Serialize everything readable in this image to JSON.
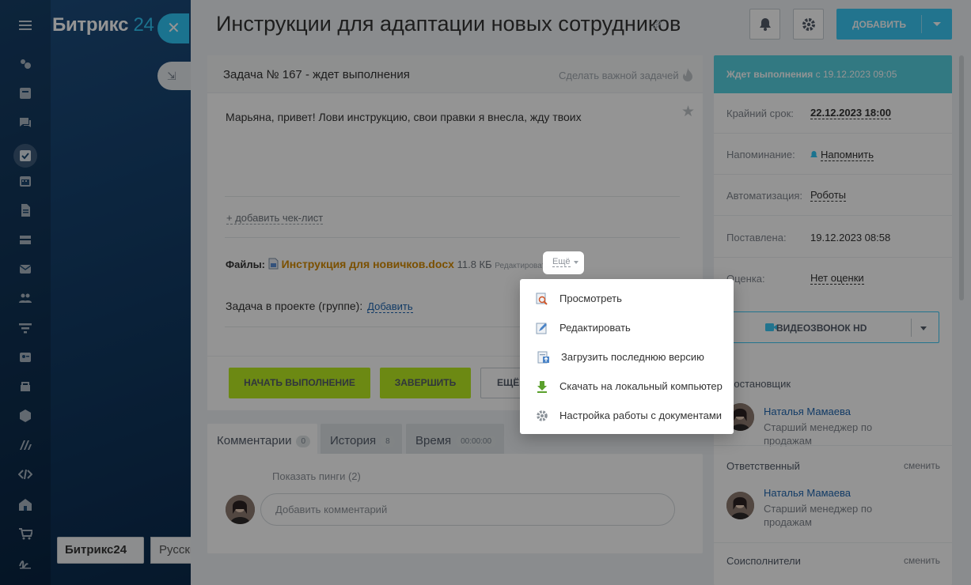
{
  "app": {
    "logo_name": "Битрикс",
    "logo_num": "24",
    "footer_logo": "Битрикс24",
    "footer_lang": "Русский"
  },
  "page": {
    "title": "Инструкции для адаптации новых сотрудников",
    "add_button": "ДОБАВИТЬ"
  },
  "task": {
    "header": "Задача № 167 - ждет выполнения",
    "important": "Сделать важной задачей",
    "description": "Марьяна, привет! Лови инструкцию, свои правки я внесла, жду твоих",
    "checklist": "+ добавить чек-лист",
    "files_label": "Файлы:",
    "file_name": "Инструкция для новичков.docx",
    "file_size": "11.8 КБ",
    "file_edit": "Редактировать",
    "file_more": "Ещё",
    "project_label": "Задача в проекте (группе):",
    "project_add": "Добавить",
    "btn_start": "НАЧАТЬ ВЫПОЛНЕНИЕ",
    "btn_finish": "ЗАВЕРШИТЬ",
    "btn_more": "ЕЩЁ"
  },
  "tabs": [
    {
      "label": "Комментарии",
      "count": "0"
    },
    {
      "label": "История",
      "count": "8"
    },
    {
      "label": "Время",
      "count": "00:00:00"
    }
  ],
  "comments": {
    "pings": "Показать пинги (2)",
    "placeholder": "Добавить комментарий"
  },
  "sidebar": {
    "status": "Ждет выполнения",
    "status_since": "с 19.12.2023 09:05",
    "deadline_label": "Крайний срок:",
    "deadline": "22.12.2023 18:00",
    "reminder_label": "Напоминание:",
    "reminder": "Напомнить",
    "automation_label": "Автоматизация:",
    "automation": "Роботы",
    "created_label": "Поставлена:",
    "created": "19.12.2023 08:58",
    "rating_label": "Оценка:",
    "rating": "Нет оценки",
    "video_call": "ВИДЕОЗВОНОК HD",
    "creator_label": "Постановщик",
    "creator_name": "Наталья Мамаева",
    "creator_role": "Старший менеджер по продажам",
    "responsible_label": "Ответственный",
    "responsible_change": "сменить",
    "responsible_name": "Наталья Мамаева",
    "responsible_role": "Старший менеджер по продажам",
    "coexec_label": "Соисполнители",
    "coexec_change": "сменить"
  },
  "file_menu": [
    {
      "label": "Просмотреть",
      "icon": "view-icon"
    },
    {
      "label": "Редактировать",
      "icon": "edit-icon"
    },
    {
      "label": "Загрузить последнюю версию",
      "icon": "upload-version-icon"
    },
    {
      "label": "Скачать на локальный компьютер",
      "icon": "download-icon"
    },
    {
      "label": "Настройка работы с документами",
      "icon": "settings-icon"
    }
  ]
}
